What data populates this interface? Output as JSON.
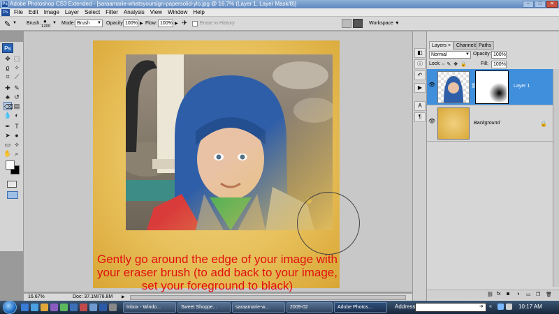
{
  "window": {
    "title": "Adobe Photoshop CS3 Extended - [saraamarie-whatsyoursign-papersolid-ylo.jpg @ 16.7% (Layer 1, Layer Mask/8)]",
    "app_badge": "Ps"
  },
  "menu": [
    "File",
    "Edit",
    "Image",
    "Layer",
    "Select",
    "Filter",
    "Analysis",
    "View",
    "Window",
    "Help"
  ],
  "options": {
    "brush_label": "Brush:",
    "brush_size": "1200",
    "mode_label": "Mode:",
    "mode_value": "Brush",
    "opacity_label": "Opacity:",
    "opacity_value": "100%",
    "flow_label": "Flow:",
    "flow_value": "100%",
    "erase_history_label": "Erase to History",
    "workspace_label": "Workspace"
  },
  "tools_panel": {
    "header": "Ps",
    "type_tool": "T"
  },
  "canvas": {
    "caption": "Gently go around the edge of your image with your eraser brush (to add back to your image, set your foreground to black)"
  },
  "status": {
    "zoom": "16.67%",
    "doc": "Doc: 37.1M/76.8M"
  },
  "layers_panel": {
    "tabs": [
      "Layers",
      "Channels",
      "Paths"
    ],
    "blend_mode": "Normal",
    "opacity_label": "Opacity:",
    "opacity_value": "100%",
    "lock_label": "Lock:",
    "fill_label": "Fill:",
    "fill_value": "100%",
    "layers": [
      {
        "name": "Layer 1",
        "selected": true
      },
      {
        "name": "Background",
        "selected": false
      }
    ],
    "dock_letters": [
      "A",
      "¶"
    ]
  },
  "taskbar": {
    "buttons": [
      "Inbox - Windo...",
      "Sweet Shoppe...",
      "saraamarie-w...",
      "2009-02",
      "Adobe Photos..."
    ],
    "address_label": "Address",
    "clock": "10:17 AM"
  },
  "colors": {
    "accent_selected": "#3f8fdc",
    "caption_red": "#e11010",
    "arrow_red": "#e41414"
  }
}
